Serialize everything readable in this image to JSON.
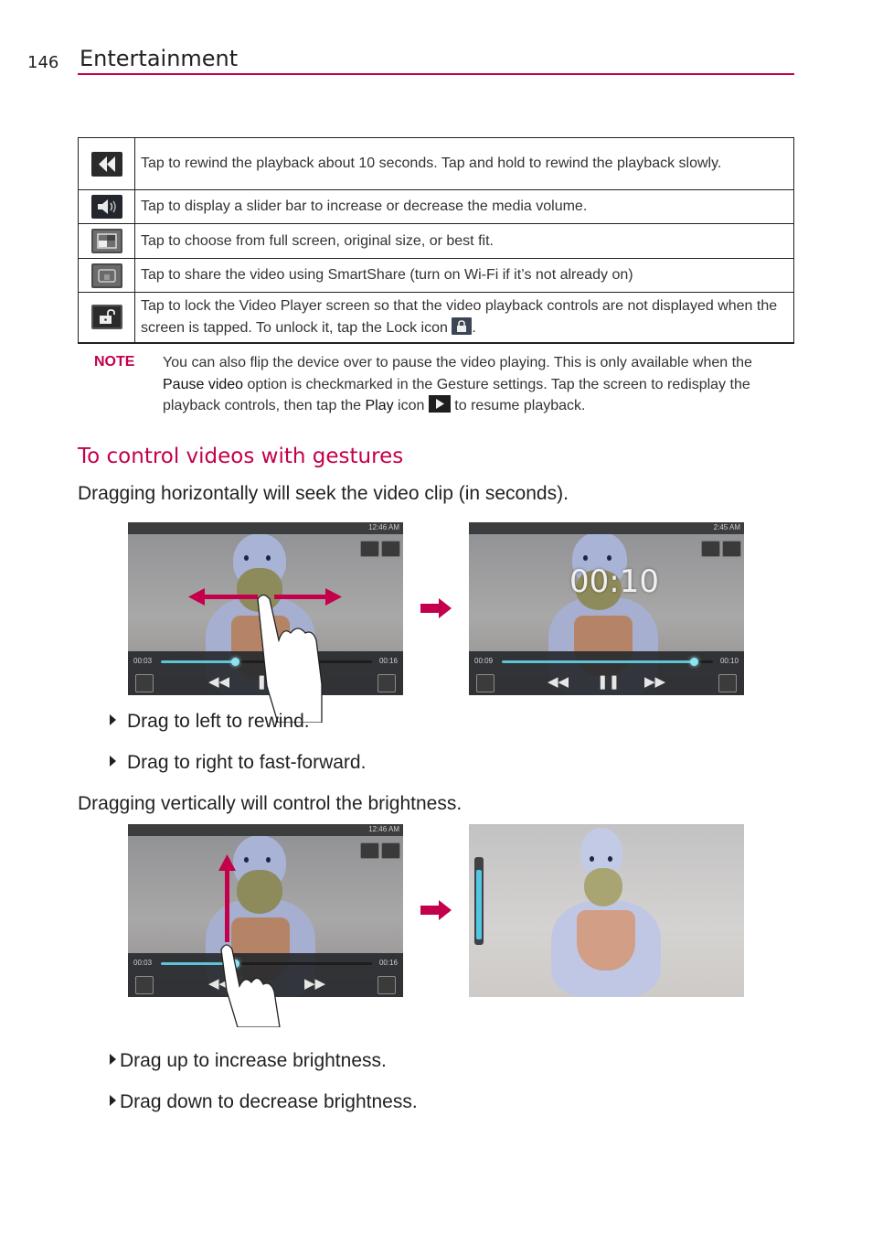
{
  "header": {
    "page_number": "146",
    "section_title": "Entertainment"
  },
  "colors": {
    "accent": "#c4004c",
    "text": "#231f20",
    "seekbar": "#5ec3d6"
  },
  "icon_table": {
    "rows": [
      {
        "icon": "rewind-icon",
        "description": "Tap to rewind the playback about 10 seconds.  Tap and hold to rewind the playback slowly."
      },
      {
        "icon": "volume-icon",
        "description": "Tap to display a slider bar to increase or decrease the media volume."
      },
      {
        "icon": "screen-size-icon",
        "description": "Tap to choose from full screen, original size, or best fit."
      },
      {
        "icon": "smartshare-icon",
        "description": "Tap to share the video using SmartShare (turn on Wi-Fi if it’s not already on)"
      },
      {
        "icon": "lock-icon",
        "description_before": "Tap to lock the Video Player screen so that the video playback controls are not displayed when the screen is tapped. To unlock it, tap the Lock icon ",
        "description_after": "."
      }
    ]
  },
  "note": {
    "label": "NOTE",
    "part1": "You can also flip the device over to pause the video playing. This is only available when the ",
    "bold1": "Pause video",
    "part2": " option is checkmarked in the Gesture settings. Tap the screen to redisplay the playback controls, then tap the ",
    "bold2": "Play",
    "part3": " icon ",
    "part4": " to resume playback."
  },
  "gestures": {
    "heading": "To control videos with gestures",
    "horizontal_intro": "Dragging horizontally will seek the video clip (in seconds).",
    "horizontal_bullets": [
      "Drag to left to rewind.",
      "Drag to right to fast-forward."
    ],
    "vertical_intro": "Dragging vertically will control the brightness.",
    "vertical_bullets": [
      "Drag up to increase brightness.",
      "Drag down to decrease brightness."
    ]
  },
  "screenshots": {
    "seek_before": {
      "status_time": "12:46 AM",
      "elapsed": "00:03",
      "duration": "00:16",
      "progress": 0.35
    },
    "seek_after": {
      "status_time": "2:45 AM",
      "elapsed": "00:09",
      "duration": "00:10",
      "progress": 0.91,
      "seek_display": "00:10"
    },
    "bright_before": {
      "status_time": "12:46 AM",
      "elapsed": "00:03",
      "duration": "00:16",
      "progress": 0.35
    },
    "bright_after": {
      "brightness": 0.9
    }
  }
}
